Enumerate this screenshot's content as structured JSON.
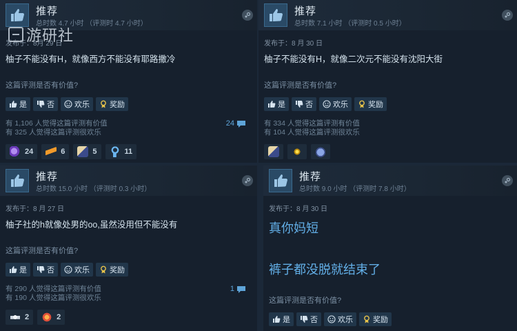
{
  "reviews": [
    {
      "title": "推荐",
      "hours": "总时数 4.7 小时 （评测时 4.7 小时）",
      "posted": "发布于：8月 29 日",
      "text": "柚子不能没有H，就像西方不能没有耶路撒冷",
      "question": "这篇评测是否有价值?",
      "btns": {
        "yes": "是",
        "no": "否",
        "funny": "欢乐",
        "award": "奖励"
      },
      "helpful": "有 1,106 人觉得这篇评测有价值",
      "funny_count": "有 325 人觉得这篇评测很欢乐",
      "comments": "24",
      "awards": [
        {
          "icon": "purple-hearts-icon",
          "count": "24",
          "color": "#9a6ad6"
        },
        {
          "icon": "orange-hand-icon",
          "count": "6",
          "color": "#e08a2a"
        },
        {
          "icon": "card-figure-icon",
          "count": "5",
          "color": "#c9b07a"
        },
        {
          "icon": "blue-medal-icon",
          "count": "11",
          "color": "#5ea4d8"
        }
      ]
    },
    {
      "title": "推荐",
      "hours": "总时数 7.1 小时 （评测时 0.5 小时）",
      "posted": "发布于：8 月 30 日",
      "text": "柚子不能没有H，就像二次元不能没有沈阳大街",
      "question": "这篇评测是否有价值?",
      "btns": {
        "yes": "是",
        "no": "否",
        "funny": "欢乐",
        "award": "奖励"
      },
      "helpful": "有 334 人觉得这篇评测有价值",
      "funny_count": "有 104 人觉得这篇评测很欢乐",
      "awards": [
        {
          "icon": "card-figure-icon",
          "color": "#c9b07a"
        },
        {
          "icon": "glow-star-icon",
          "color": "#e8c020"
        },
        {
          "icon": "monster-face-icon",
          "color": "#6a86c8"
        }
      ]
    },
    {
      "title": "推荐",
      "hours": "总时数 15.0 小时 （评测时 0.3 小时）",
      "posted": "发布于：8 月 27 日",
      "text": "柚子社的h就像处男的oo,虽然没用但不能没有",
      "question": "这篇评测是否有价值?",
      "btns": {
        "yes": "是",
        "no": "否",
        "funny": "欢乐",
        "award": "奖励"
      },
      "helpful": "有 290 人觉得这篇评测有价值",
      "funny_count": "有 190 人觉得这篇评测很欢乐",
      "comments": "1",
      "awards": [
        {
          "icon": "winged-badge-icon",
          "count": "2",
          "color": "#dfe6ee"
        },
        {
          "icon": "laughing-face-icon",
          "count": "2",
          "color": "#e86a3a"
        }
      ]
    },
    {
      "title": "推荐",
      "hours": "总时数 9.0 小时 （评测时 7.8 小时）",
      "posted": "发布于：8 月 30 日",
      "text_line1": "真你妈短",
      "text_line2": "裤子都没脱就结束了",
      "question": "这篇评测是否有价值?",
      "btns": {
        "yes": "是",
        "no": "否",
        "funny": "欢乐",
        "award": "奖励"
      }
    }
  ],
  "watermark": "游研社"
}
